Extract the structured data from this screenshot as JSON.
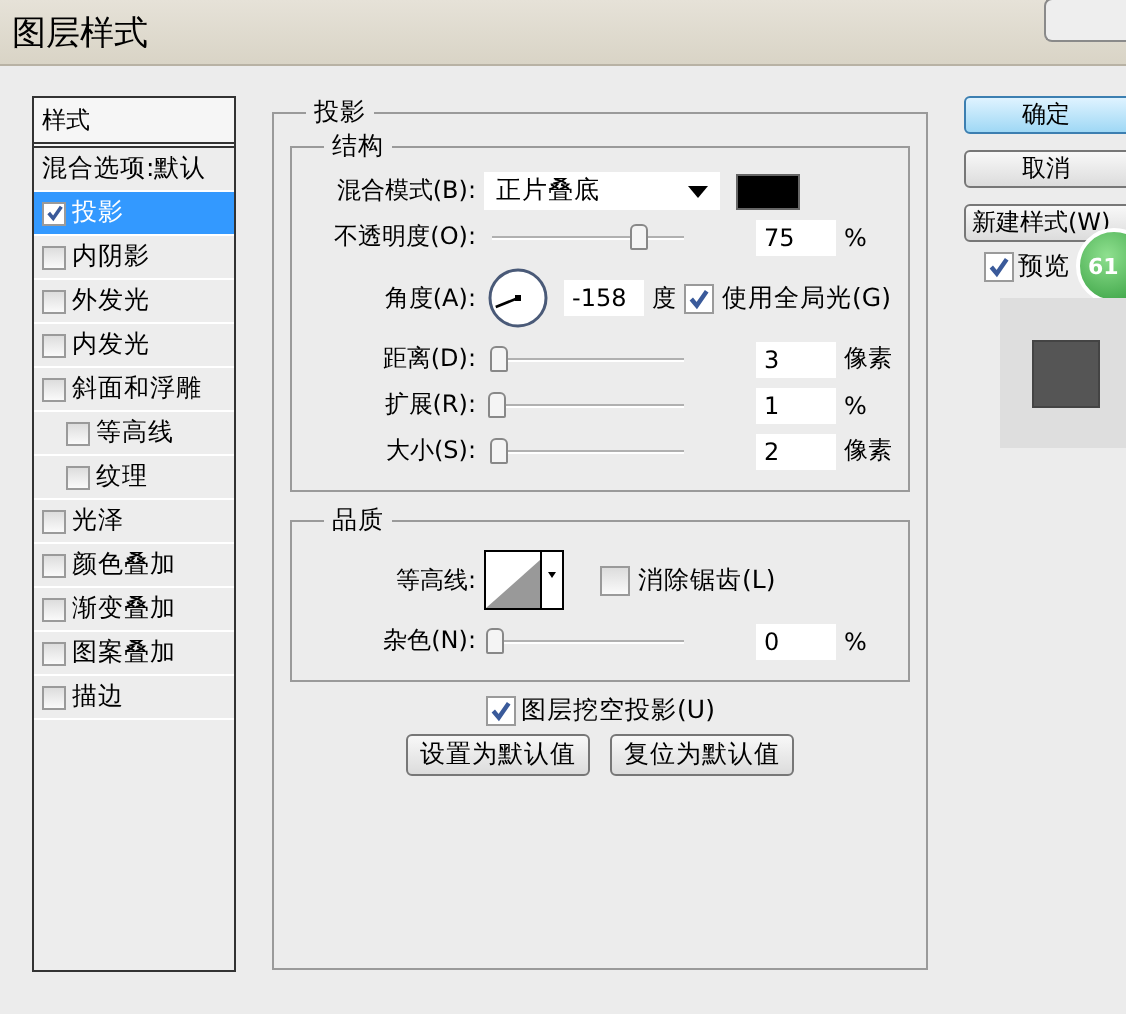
{
  "window": {
    "title": "图层样式"
  },
  "style_list": {
    "header": "样式",
    "items": [
      {
        "label": "混合选项:默认",
        "kind": "plain",
        "selected": false
      },
      {
        "label": "投影",
        "kind": "check",
        "checked": true,
        "selected": true
      },
      {
        "label": "内阴影",
        "kind": "check",
        "checked": false,
        "selected": false
      },
      {
        "label": "外发光",
        "kind": "check",
        "checked": false,
        "selected": false
      },
      {
        "label": "内发光",
        "kind": "check",
        "checked": false,
        "selected": false
      },
      {
        "label": "斜面和浮雕",
        "kind": "check",
        "checked": false,
        "selected": false,
        "children": [
          {
            "label": "等高线",
            "kind": "check",
            "checked": false,
            "selected": false
          },
          {
            "label": "纹理",
            "kind": "check",
            "checked": false,
            "selected": false
          }
        ]
      },
      {
        "label": "光泽",
        "kind": "check",
        "checked": false,
        "selected": false
      },
      {
        "label": "颜色叠加",
        "kind": "check",
        "checked": false,
        "selected": false
      },
      {
        "label": "渐变叠加",
        "kind": "check",
        "checked": false,
        "selected": false
      },
      {
        "label": "图案叠加",
        "kind": "check",
        "checked": false,
        "selected": false
      },
      {
        "label": "描边",
        "kind": "check",
        "checked": false,
        "selected": false
      }
    ]
  },
  "drop_shadow": {
    "title": "投影",
    "structure": {
      "title": "结构",
      "blend_mode": {
        "label": "混合模式(B):",
        "value": "正片叠底"
      },
      "opacity": {
        "label": "不透明度(O):",
        "level": 0.75,
        "value": "75",
        "unit": "%"
      },
      "angle": {
        "label": "角度(A):",
        "value": "-158",
        "unit": "度",
        "global_light": {
          "label": "使用全局光(G)",
          "checked": true
        }
      },
      "sliders": [
        {
          "label": "距离(D):",
          "level": 0.02,
          "value": "3",
          "unit": "像素"
        },
        {
          "label": "扩展(R):",
          "level": 0.01,
          "value": "1",
          "unit": "%"
        },
        {
          "label": "大小(S):",
          "level": 0.02,
          "value": "2",
          "unit": "像素"
        }
      ]
    },
    "quality": {
      "title": "品质",
      "contour_label": "等高线:",
      "anti_alias": {
        "label": "消除锯齿(L)",
        "checked": false
      },
      "noise": {
        "label": "杂色(N):",
        "level": 0,
        "value": "0",
        "unit": "%"
      }
    },
    "knockout": {
      "label": "图层挖空投影(U)",
      "checked": true
    },
    "buttons": [
      "设置为默认值",
      "复位为默认值"
    ]
  },
  "side_buttons": [
    {
      "label": "确定",
      "kind": "default"
    },
    {
      "label": "取消",
      "kind": "normal"
    },
    {
      "label": "新建样式(W)",
      "kind": "normal"
    }
  ],
  "preview": {
    "label": "预览",
    "checked": true
  },
  "badge": "61"
}
